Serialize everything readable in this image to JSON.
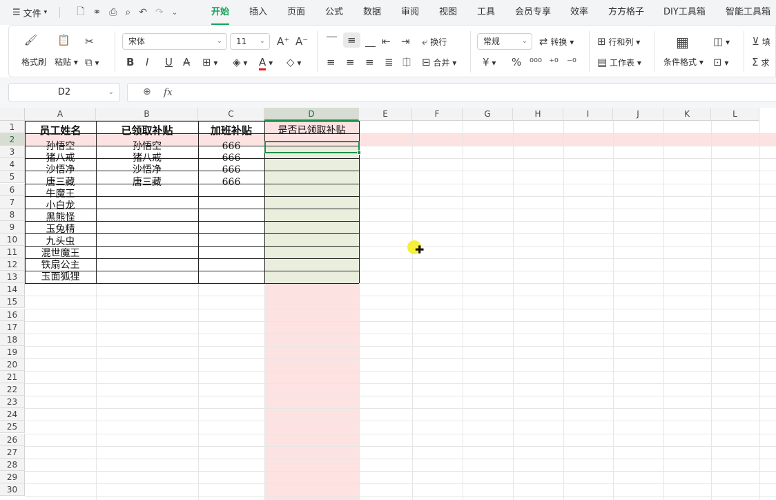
{
  "menubar": {
    "file_label": "文件",
    "tabs": [
      "开始",
      "插入",
      "页面",
      "公式",
      "数据",
      "审阅",
      "视图",
      "工具",
      "会员专享",
      "效率",
      "方方格子",
      "DIY工具箱",
      "智能工具箱"
    ],
    "active_tab": "开始"
  },
  "ribbon": {
    "format_painter": "格式刷",
    "paste": "粘贴",
    "font_name": "宋体",
    "font_size": "11",
    "wrap_text": "换行",
    "merge": "合并",
    "number_format": "常规",
    "convert": "转换",
    "row_col": "行和列",
    "worksheet": "工作表",
    "cond_format": "条件格式",
    "fill": "填",
    "sum": "求"
  },
  "formula_bar": {
    "name_box": "D2",
    "fx_label": "fx",
    "formula": ""
  },
  "sheet": {
    "columns": [
      "A",
      "B",
      "C",
      "D",
      "E",
      "F",
      "G",
      "H",
      "I",
      "J",
      "K",
      "L"
    ],
    "rows": [
      "1",
      "2",
      "3",
      "4",
      "5",
      "6",
      "7",
      "8",
      "9",
      "10",
      "11",
      "12",
      "13",
      "14",
      "15",
      "16",
      "17",
      "18",
      "19",
      "20",
      "21",
      "22",
      "23",
      "24",
      "25",
      "26",
      "27",
      "28",
      "29",
      "30"
    ],
    "headers": [
      "员工姓名",
      "已领取补贴",
      "加班补贴",
      "是否已领取补贴"
    ],
    "data": [
      [
        "孙悟空",
        "孙悟空",
        "666",
        ""
      ],
      [
        "猪八戒",
        "猪八戒",
        "666",
        ""
      ],
      [
        "沙悟净",
        "沙悟净",
        "666",
        ""
      ],
      [
        "唐三藏",
        "唐三藏",
        "666",
        ""
      ],
      [
        "牛魔王",
        "",
        "",
        ""
      ],
      [
        "小白龙",
        "",
        "",
        ""
      ],
      [
        "黑熊怪",
        "",
        "",
        ""
      ],
      [
        "玉兔精",
        "",
        "",
        ""
      ],
      [
        "九头虫",
        "",
        "",
        ""
      ],
      [
        "混世魔王",
        "",
        "",
        ""
      ],
      [
        "铁扇公主",
        "",
        "",
        ""
      ],
      [
        "玉面狐狸",
        "",
        "",
        ""
      ]
    ],
    "active_cell": "D2",
    "colors": {
      "highlight": "#fde2e2",
      "selected_fill": "#e9eedd",
      "active_border": "#1e8e4d",
      "header_active": "#d8ddd3"
    }
  }
}
